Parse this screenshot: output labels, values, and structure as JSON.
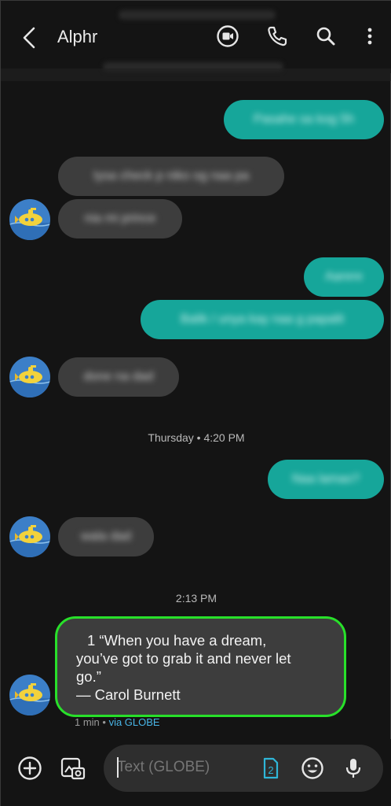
{
  "header": {
    "title": "Alphr"
  },
  "messages": {
    "out1": "Pasahe sa kog 5h",
    "in1": "Iysa check p niko og naa pa",
    "in2": "nia mi prince",
    "out2": "Aarere",
    "out3": "Balik / unya kay naa g papalit",
    "in3": "done na dad",
    "out4": "Naa lamao?",
    "in4": "wala dad"
  },
  "timestamps": {
    "t1": "Thursday • 4:20 PM",
    "t2": "2:13 PM"
  },
  "quote": {
    "line1": "1 “When you have a dream,",
    "line2": "you’ve got to grab it and never let",
    "line3": "go.”",
    "line4": "— Carol Burnett"
  },
  "meta": {
    "age": "1 min • ",
    "via": "via GLOBE"
  },
  "composer": {
    "placeholder": "Text (GLOBE)",
    "sim_badge": "2"
  },
  "colors": {
    "outgoing": "#16a69a",
    "incoming": "#3d3d3d",
    "highlight": "#28e02a",
    "background": "#141414"
  },
  "icons": [
    "back-arrow-icon",
    "video-call-icon",
    "phone-icon",
    "search-icon",
    "more-vert-icon",
    "add-icon",
    "gallery-icon",
    "sim-card-icon",
    "emoji-icon",
    "mic-icon",
    "avatar-submarine-icon"
  ]
}
